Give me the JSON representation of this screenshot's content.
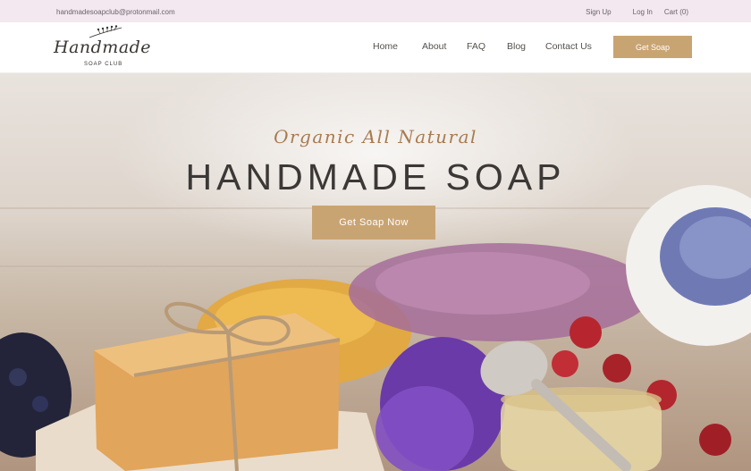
{
  "topbar": {
    "email": "handmadesoapclub@protonmail.com",
    "signup": "Sign Up",
    "login": "Log In",
    "cart": "Cart (0)"
  },
  "logo": {
    "script": "Handmade",
    "sub": "SOAP CLUB"
  },
  "nav": {
    "home": "Home",
    "about": "About",
    "faq": "FAQ",
    "blog": "Blog",
    "contact": "Contact Us",
    "cta": "Get Soap"
  },
  "hero": {
    "tagline": "Organic All Natural",
    "headline": "HANDMADE SOAP",
    "cta": "Get Soap Now"
  },
  "colors": {
    "accent": "#c9a473",
    "topbar_bg": "#f3e8f0",
    "heading": "#3c3836",
    "script": "#a87b4f"
  }
}
